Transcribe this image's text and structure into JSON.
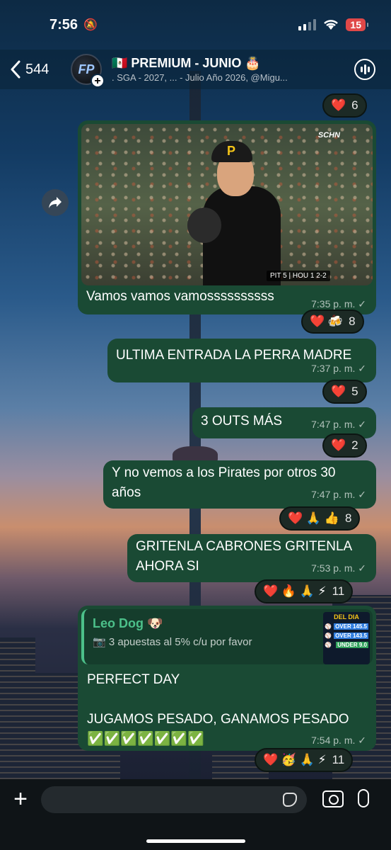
{
  "status": {
    "time": "7:56",
    "battery": "15"
  },
  "header": {
    "back_count": "544",
    "avatar_text": "FP",
    "title": "🇲🇽 PREMIUM - JUNIO 🎂",
    "subtitle": ". SGA - 2027, ... - Julio Año 2026, @Migu..."
  },
  "colors": {
    "bubble": "#1a4a34",
    "accent": "#4cc08a",
    "battery": "#e04848"
  },
  "top_reaction": {
    "emojis": "❤️",
    "count": "6"
  },
  "photo_message": {
    "caption": "Vamos vamos vamossssssssss",
    "time": "7:35 p. m. ✓",
    "reactions": "❤️ 🍻",
    "count": "8",
    "network": "SCHN",
    "scorebug": "PIT 5 | HOU 1  2-2"
  },
  "messages": [
    {
      "text": "ULTIMA ENTRADA LA PERRA MADRE",
      "time": "7:37 p. m. ✓",
      "reactions": "❤️",
      "count": "5"
    },
    {
      "text": "3 OUTS MÁS",
      "time": "7:47 p. m. ✓",
      "reactions": "❤️",
      "count": "2"
    },
    {
      "text": "Y no vemos a los Pirates por otros 30 años",
      "time": "7:47 p. m. ✓",
      "reactions": "❤️ 🙏 👍",
      "count": "8"
    },
    {
      "text": "GRITENLA CABRONES GRITENLA AHORA SI",
      "time": "7:53 p. m. ✓",
      "reactions": "❤️ 🔥 🙏 ⚡",
      "count": "11"
    }
  ],
  "reply_message": {
    "quote_name": "Leo Dog 🐶",
    "quote_text": "📷 3 apuestas al 5% c/u por favor",
    "thumb_title": "DEL DIA",
    "thumb_tags": [
      "OVER 145.5",
      "OVER 143.5",
      "UNDER 9.0"
    ],
    "line1": "PERFECT DAY",
    "line2": "JUGAMOS PESADO, GANAMOS PESADO",
    "checks": "✅✅✅✅✅✅✅",
    "time": "7:54 p. m. ✓",
    "reactions": "❤️ 🥳 🙏 ⚡",
    "count": "11"
  }
}
